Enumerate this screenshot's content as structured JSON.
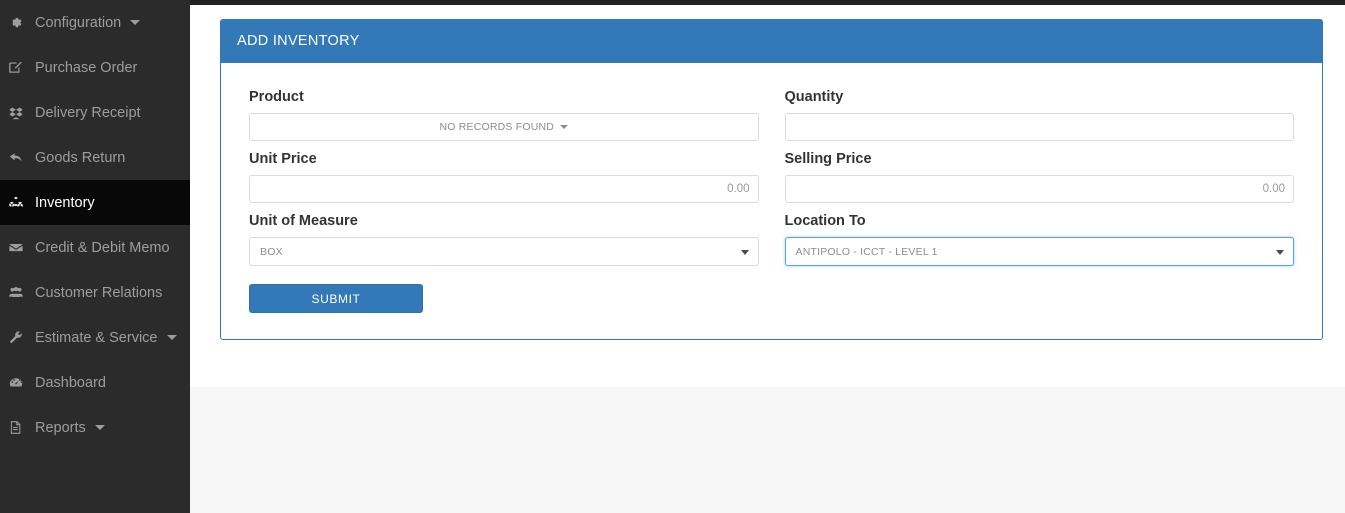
{
  "sidebar": {
    "items": [
      {
        "label": "Configuration",
        "icon": "gear-icon",
        "caret": true,
        "active": false
      },
      {
        "label": "Purchase Order",
        "icon": "edit-icon",
        "caret": false,
        "active": false
      },
      {
        "label": "Delivery Receipt",
        "icon": "dropbox-icon",
        "caret": false,
        "active": false
      },
      {
        "label": "Goods Return",
        "icon": "reply-icon",
        "caret": false,
        "active": false
      },
      {
        "label": "Inventory",
        "icon": "cubes-icon",
        "caret": false,
        "active": true
      },
      {
        "label": "Credit & Debit Memo",
        "icon": "envelope-icon",
        "caret": false,
        "active": false
      },
      {
        "label": "Customer Relations",
        "icon": "users-icon",
        "caret": false,
        "active": false
      },
      {
        "label": "Estimate & Service",
        "icon": "wrench-icon",
        "caret": true,
        "active": false
      },
      {
        "label": "Dashboard",
        "icon": "dashboard-icon",
        "caret": false,
        "active": false
      },
      {
        "label": "Reports",
        "icon": "file-icon",
        "caret": true,
        "active": false
      }
    ]
  },
  "panel": {
    "title": "ADD INVENTORY",
    "fields": {
      "product": {
        "label": "Product",
        "value": "NO RECORDS FOUND"
      },
      "quantity": {
        "label": "Quantity",
        "value": "",
        "placeholder": ""
      },
      "unit_price": {
        "label": "Unit Price",
        "value": "",
        "placeholder": "0.00"
      },
      "selling_price": {
        "label": "Selling Price",
        "value": "",
        "placeholder": "0.00"
      },
      "unit_of_measure": {
        "label": "Unit of Measure",
        "value": "BOX"
      },
      "location_to": {
        "label": "Location To",
        "value": "ANTIPOLO - ICCT - LEVEL 1"
      }
    },
    "submit_label": "SUBMIT"
  },
  "colors": {
    "accent": "#3479b7",
    "sidebar_bg": "#2b2b2b",
    "sidebar_active_bg": "#080808",
    "page_bg": "#f6f6f6",
    "focus_border": "#5ba3de"
  }
}
